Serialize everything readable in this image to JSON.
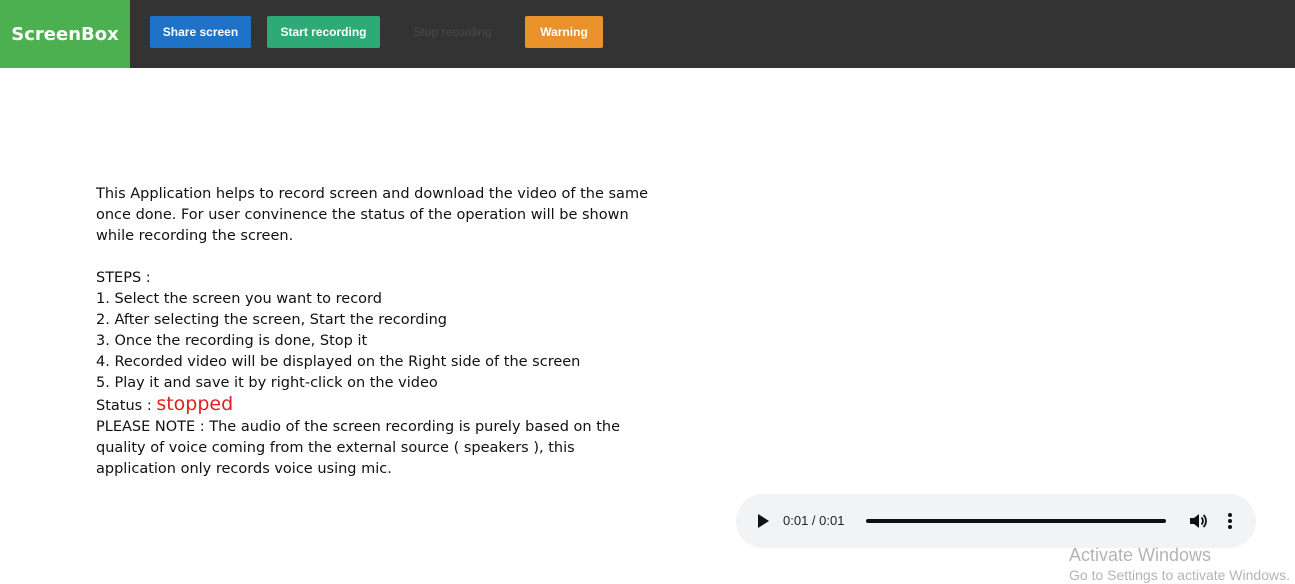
{
  "header": {
    "brand": "ScreenBox",
    "buttons": {
      "share": "Share screen",
      "start": "Start recording",
      "stop": "Stop recording",
      "warning": "Warning"
    }
  },
  "content": {
    "description": "This Application helps to record screen and download the video of the same once done. For user convinence the status of the operation will be shown while recording the screen.",
    "steps_title": "STEPS :",
    "steps": [
      "1. Select the screen you want to record",
      "2. After selecting the screen, Start the recording",
      "3. Once the recording is done, Stop it",
      "4. Recorded video will be displayed on the Right side of the screen",
      "5. Play it and save it by right-click on the video"
    ],
    "status_label": "Status :",
    "status_value": "stopped",
    "note": "PLEASE NOTE : The audio of the screen recording is purely based on the quality of voice coming from the external source ( speakers ), this application only records voice using mic."
  },
  "player": {
    "time": "0:01 / 0:01",
    "progress": 1.0
  },
  "watermark": {
    "line1": "Activate Windows",
    "line2": "Go to Settings to activate Windows."
  },
  "colors": {
    "brand": "#4caf50",
    "share": "#1e73c8",
    "start": "#2eaa76",
    "warning": "#e9912a",
    "status": "#e02020"
  }
}
